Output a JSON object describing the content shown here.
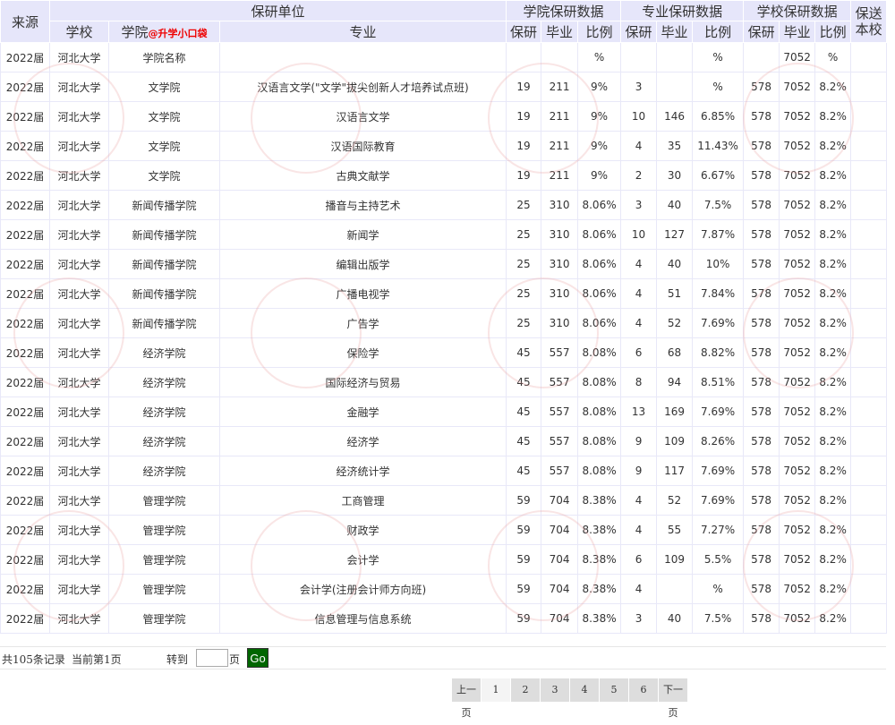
{
  "header": {
    "source": "来源",
    "unit": "保研单位",
    "school": "学校",
    "college": "学院",
    "college_tag": "@升学小口袋",
    "major": "专业",
    "college_data": "学院保研数据",
    "major_data": "专业保研数据",
    "school_data": "学校保研数据",
    "recommend": "保送本校",
    "baoyan": "保研",
    "biye": "毕业",
    "bili": "比例"
  },
  "rows": [
    [
      "2022届",
      "河北大学",
      "学院名称",
      "",
      "",
      "",
      "%",
      "",
      "",
      "%",
      "",
      "7052",
      "%",
      ""
    ],
    [
      "2022届",
      "河北大学",
      "文学院",
      "汉语言文学(\"文学\"拔尖创新人才培养试点班)",
      "19",
      "211",
      "9%",
      "3",
      "",
      "%",
      "578",
      "7052",
      "8.2%",
      ""
    ],
    [
      "2022届",
      "河北大学",
      "文学院",
      "汉语言文学",
      "19",
      "211",
      "9%",
      "10",
      "146",
      "6.85%",
      "578",
      "7052",
      "8.2%",
      ""
    ],
    [
      "2022届",
      "河北大学",
      "文学院",
      "汉语国际教育",
      "19",
      "211",
      "9%",
      "4",
      "35",
      "11.43%",
      "578",
      "7052",
      "8.2%",
      ""
    ],
    [
      "2022届",
      "河北大学",
      "文学院",
      "古典文献学",
      "19",
      "211",
      "9%",
      "2",
      "30",
      "6.67%",
      "578",
      "7052",
      "8.2%",
      ""
    ],
    [
      "2022届",
      "河北大学",
      "新闻传播学院",
      "播音与主持艺术",
      "25",
      "310",
      "8.06%",
      "3",
      "40",
      "7.5%",
      "578",
      "7052",
      "8.2%",
      ""
    ],
    [
      "2022届",
      "河北大学",
      "新闻传播学院",
      "新闻学",
      "25",
      "310",
      "8.06%",
      "10",
      "127",
      "7.87%",
      "578",
      "7052",
      "8.2%",
      ""
    ],
    [
      "2022届",
      "河北大学",
      "新闻传播学院",
      "编辑出版学",
      "25",
      "310",
      "8.06%",
      "4",
      "40",
      "10%",
      "578",
      "7052",
      "8.2%",
      ""
    ],
    [
      "2022届",
      "河北大学",
      "新闻传播学院",
      "广播电视学",
      "25",
      "310",
      "8.06%",
      "4",
      "51",
      "7.84%",
      "578",
      "7052",
      "8.2%",
      ""
    ],
    [
      "2022届",
      "河北大学",
      "新闻传播学院",
      "广告学",
      "25",
      "310",
      "8.06%",
      "4",
      "52",
      "7.69%",
      "578",
      "7052",
      "8.2%",
      ""
    ],
    [
      "2022届",
      "河北大学",
      "经济学院",
      "保险学",
      "45",
      "557",
      "8.08%",
      "6",
      "68",
      "8.82%",
      "578",
      "7052",
      "8.2%",
      ""
    ],
    [
      "2022届",
      "河北大学",
      "经济学院",
      "国际经济与贸易",
      "45",
      "557",
      "8.08%",
      "8",
      "94",
      "8.51%",
      "578",
      "7052",
      "8.2%",
      ""
    ],
    [
      "2022届",
      "河北大学",
      "经济学院",
      "金融学",
      "45",
      "557",
      "8.08%",
      "13",
      "169",
      "7.69%",
      "578",
      "7052",
      "8.2%",
      ""
    ],
    [
      "2022届",
      "河北大学",
      "经济学院",
      "经济学",
      "45",
      "557",
      "8.08%",
      "9",
      "109",
      "8.26%",
      "578",
      "7052",
      "8.2%",
      ""
    ],
    [
      "2022届",
      "河北大学",
      "经济学院",
      "经济统计学",
      "45",
      "557",
      "8.08%",
      "9",
      "117",
      "7.69%",
      "578",
      "7052",
      "8.2%",
      ""
    ],
    [
      "2022届",
      "河北大学",
      "管理学院",
      "工商管理",
      "59",
      "704",
      "8.38%",
      "4",
      "52",
      "7.69%",
      "578",
      "7052",
      "8.2%",
      ""
    ],
    [
      "2022届",
      "河北大学",
      "管理学院",
      "财政学",
      "59",
      "704",
      "8.38%",
      "4",
      "55",
      "7.27%",
      "578",
      "7052",
      "8.2%",
      ""
    ],
    [
      "2022届",
      "河北大学",
      "管理学院",
      "会计学",
      "59",
      "704",
      "8.38%",
      "6",
      "109",
      "5.5%",
      "578",
      "7052",
      "8.2%",
      ""
    ],
    [
      "2022届",
      "河北大学",
      "管理学院",
      "会计学(注册会计师方向班)",
      "59",
      "704",
      "8.38%",
      "4",
      "",
      "%",
      "578",
      "7052",
      "8.2%",
      ""
    ],
    [
      "2022届",
      "河北大学",
      "管理学院",
      "信息管理与信息系统",
      "59",
      "704",
      "8.38%",
      "3",
      "40",
      "7.5%",
      "578",
      "7052",
      "8.2%",
      ""
    ]
  ],
  "footer": {
    "records": "共105条记录",
    "current": "当前第1页",
    "goto": "转到",
    "page_unit": "页",
    "go": "Go"
  },
  "pager": {
    "prev": "上一页",
    "pages": [
      "1",
      "2",
      "3",
      "4",
      "5",
      "6"
    ],
    "next": "下一页"
  }
}
